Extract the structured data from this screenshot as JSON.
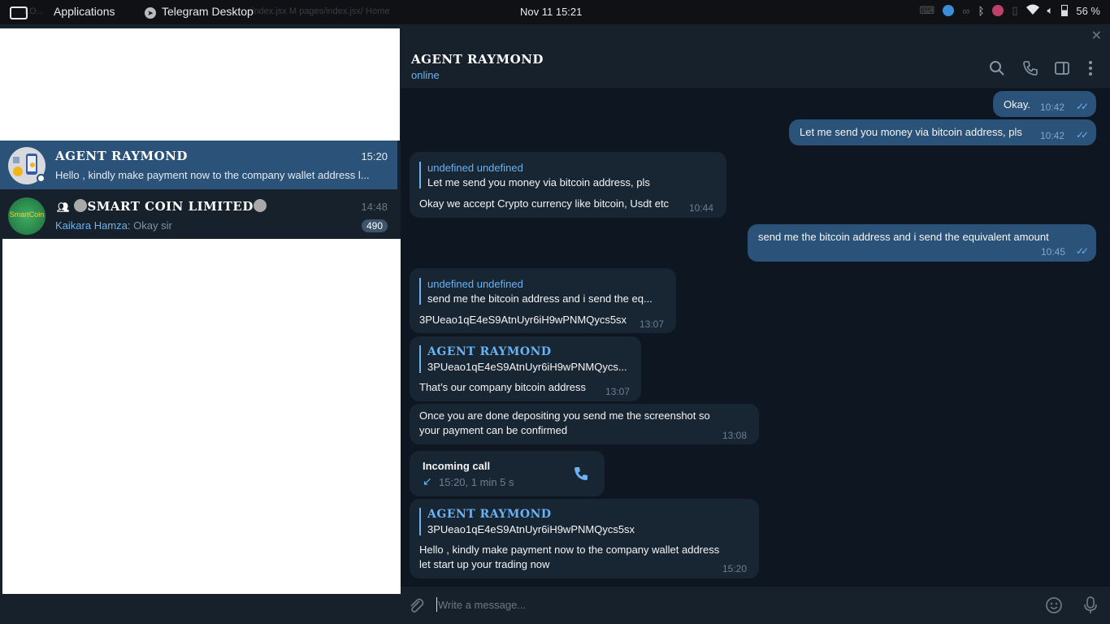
{
  "topbar": {
    "apps_label": "Applications",
    "window_label": "Telegram Desktop",
    "clock": "Nov 11  15:21",
    "battery": "56 %",
    "ghost_left": "LO...",
    "ghost_tabs": "index.jsx  M pages/index.jsx/  Home"
  },
  "chats": [
    {
      "name": "AGENT RAYMOND",
      "time": "15:20",
      "preview": "Hello , kindly make payment now to the company wallet address l...",
      "active": true
    },
    {
      "name": "SMART COIN LIMITED",
      "time": "14:48",
      "sender": "Kaikara Hamza:",
      "preview": "Okay sir",
      "badge": "490",
      "avatar_text": "SmartCoin"
    }
  ],
  "header": {
    "title": "AGENT RAYMOND",
    "status": "online"
  },
  "messages": {
    "m1": {
      "text": "Okay.",
      "time": "10:42"
    },
    "m2": {
      "text": "Let me send you money via bitcoin address, pls",
      "time": "10:42"
    },
    "m3": {
      "reply_name": "undefined undefined",
      "reply_text": "Let me send you money via bitcoin address, pls",
      "text": "Okay we accept Crypto currency like bitcoin, Usdt etc",
      "time": "10:44"
    },
    "m4": {
      "text": "send me the bitcoin address and i send the equivalent amount",
      "time": "10:45"
    },
    "m5": {
      "reply_name": "undefined undefined",
      "reply_text": "send me the bitcoin address and i send the eq...",
      "text": "3PUeao1qE4eS9AtnUyr6iH9wPNMQycs5sx",
      "time": "13:07"
    },
    "m6": {
      "reply_name": "AGENT RAYMOND",
      "reply_text": "3PUeao1qE4eS9AtnUyr6iH9wPNMQycs...",
      "text": "That’s our company bitcoin address",
      "time": "13:07"
    },
    "m7": {
      "line1": "Once you are done depositing you send me the screenshot so",
      "line2": "your payment can be confirmed",
      "time": "13:08"
    },
    "m8": {
      "title": "Incoming call",
      "detail": "15:20, 1 min 5 s"
    },
    "m9": {
      "reply_name": "AGENT RAYMOND",
      "reply_text": "3PUeao1qE4eS9AtnUyr6iH9wPNMQycs5sx",
      "line1": "Hello , kindly make payment now to the company wallet address",
      "line2": "let start up your trading now",
      "time": "15:20"
    }
  },
  "composer": {
    "placeholder": "Write a message..."
  },
  "colors": {
    "accent": "#6ab2f2",
    "out_bubble": "#2b5278",
    "in_bubble": "#182533",
    "chat_bg": "#0e1621"
  }
}
